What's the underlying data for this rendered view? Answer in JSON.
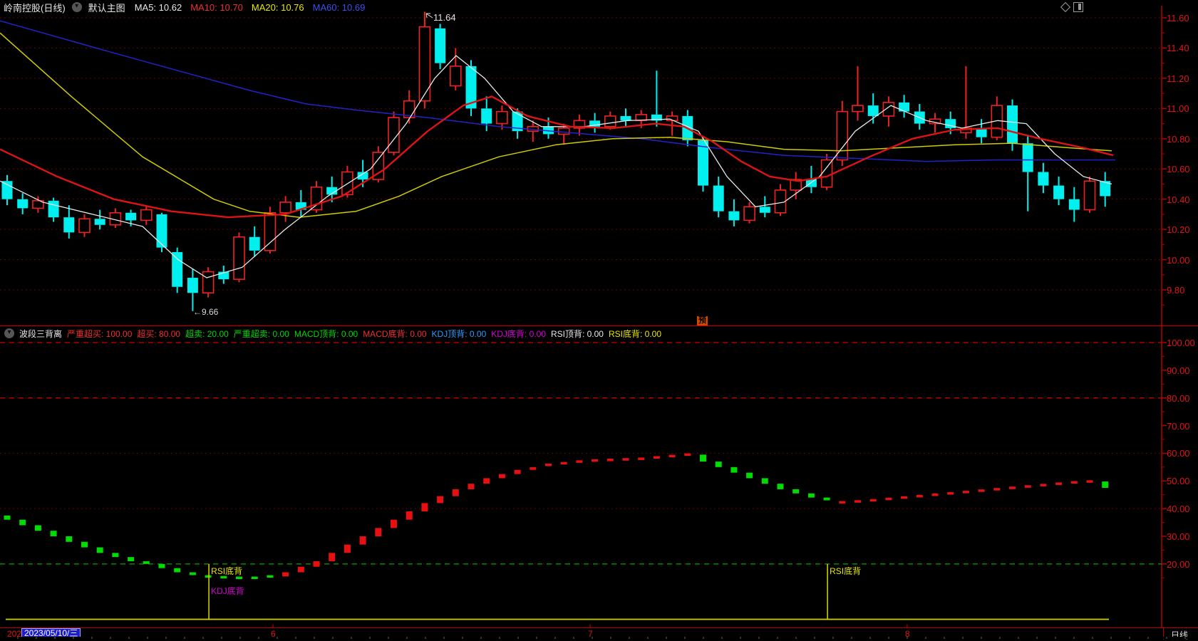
{
  "titlebar": {
    "symbol": "岭南控股(日线)",
    "preset": "默认主图",
    "ma_labels": [
      {
        "text": "MA5: 10.62",
        "color": "#e8e8e8"
      },
      {
        "text": "MA10: 10.70",
        "color": "#f03030"
      },
      {
        "text": "MA20: 10.76",
        "color": "#e8e800"
      },
      {
        "text": "MA60: 10.69",
        "color": "#3c50f0"
      }
    ]
  },
  "main_chart": {
    "y_ticks": [
      "11.60",
      "11.40",
      "11.20",
      "11.00",
      "10.80",
      "10.60",
      "10.40",
      "10.20",
      "10.00",
      "9.80"
    ],
    "high_label": "11.64",
    "low_arrow": "←",
    "low_label": "9.66",
    "alert_badge": "预"
  },
  "indicator_header": {
    "title": "波段三背离",
    "params": [
      {
        "text": "严重超买: 100.00",
        "color": "#f03030"
      },
      {
        "text": "超买: 80.00",
        "color": "#f03030"
      },
      {
        "text": "超卖: 20.00",
        "color": "#00d800"
      },
      {
        "text": "严重超卖: 0.00",
        "color": "#00d800"
      },
      {
        "text": "MACD顶背: 0.00",
        "color": "#00d800"
      },
      {
        "text": "MACD底背: 0.00",
        "color": "#f03030"
      },
      {
        "text": "KDJ顶背: 0.00",
        "color": "#2e9bff"
      },
      {
        "text": "KDJ底背: 0.00",
        "color": "#d800d8"
      },
      {
        "text": "RSI顶背: 0.00",
        "color": "#e8e8e8"
      },
      {
        "text": "RSI底背: 0.00",
        "color": "#e8e800"
      }
    ]
  },
  "indicator_panel": {
    "y_ticks": [
      "100.00",
      "90.00",
      "80.00",
      "70.00",
      "60.00",
      "50.00",
      "40.00",
      "30.00",
      "20.00"
    ],
    "annotations": [
      {
        "bar_index": 13,
        "labels": [
          {
            "text": "RSI底背",
            "color": "#e8e800"
          },
          {
            "text": "KDJ底背",
            "color": "#d800d8"
          }
        ]
      },
      {
        "bar_index": 53,
        "labels": [
          {
            "text": "RSI底背",
            "color": "#e8e800"
          }
        ]
      }
    ]
  },
  "bottom_bar": {
    "year_partial": "202",
    "date_box": "2023/05/10/三",
    "axis_labels": [
      {
        "text": "6",
        "x": 380
      },
      {
        "text": "7",
        "x": 825
      },
      {
        "text": "8",
        "x": 1270
      }
    ],
    "period": "日线"
  },
  "chart_data": {
    "type": "candlestick",
    "title": "岭南控股 日线",
    "price_axis": {
      "min": 9.66,
      "max": 11.64,
      "gridline_values": [
        11.6,
        11.4,
        11.2,
        11.0,
        10.8,
        10.6,
        10.4,
        10.2,
        10.0,
        9.8
      ]
    },
    "colors": {
      "up": "#ee2222",
      "down": "#00f0f0",
      "grid": "#8e0000",
      "axis": "#b40000",
      "ma5": "#e8e8e8",
      "ma10": "#dc1414",
      "ma20": "#cccc00",
      "ma60": "#2222cc",
      "bar_up": "#e61010",
      "bar_down": "#00dc00",
      "zero_line": "#c8c800",
      "ann_line": "#d8d800"
    },
    "candles": [
      [
        10.52,
        10.56,
        10.36,
        10.4
      ],
      [
        10.4,
        10.44,
        10.3,
        10.34
      ],
      [
        10.34,
        10.42,
        10.31,
        10.39
      ],
      [
        10.39,
        10.41,
        10.25,
        10.28
      ],
      [
        10.28,
        10.36,
        10.14,
        10.18
      ],
      [
        10.18,
        10.3,
        10.15,
        10.27
      ],
      [
        10.27,
        10.33,
        10.2,
        10.23
      ],
      [
        10.23,
        10.34,
        10.21,
        10.31
      ],
      [
        10.31,
        10.33,
        10.22,
        10.26
      ],
      [
        10.26,
        10.36,
        10.23,
        10.33
      ],
      [
        10.3,
        10.31,
        10.05,
        10.08
      ],
      [
        10.05,
        10.08,
        9.78,
        9.82
      ],
      [
        9.88,
        9.94,
        9.66,
        9.78
      ],
      [
        9.78,
        9.95,
        9.75,
        9.92
      ],
      [
        9.92,
        9.96,
        9.84,
        9.87
      ],
      [
        9.87,
        10.18,
        9.85,
        10.15
      ],
      [
        10.15,
        10.22,
        10.02,
        10.06
      ],
      [
        10.06,
        10.35,
        10.04,
        10.31
      ],
      [
        10.31,
        10.42,
        10.25,
        10.38
      ],
      [
        10.38,
        10.46,
        10.28,
        10.33
      ],
      [
        10.33,
        10.52,
        10.31,
        10.48
      ],
      [
        10.48,
        10.55,
        10.38,
        10.43
      ],
      [
        10.43,
        10.62,
        10.41,
        10.58
      ],
      [
        10.58,
        10.66,
        10.48,
        10.53
      ],
      [
        10.53,
        10.75,
        10.51,
        10.71
      ],
      [
        10.71,
        10.98,
        10.69,
        10.94
      ],
      [
        10.94,
        11.12,
        10.9,
        11.05
      ],
      [
        11.05,
        11.64,
        11.0,
        11.54
      ],
      [
        11.53,
        11.56,
        11.26,
        11.3
      ],
      [
        11.15,
        11.4,
        11.12,
        11.28
      ],
      [
        11.28,
        11.32,
        10.95,
        11.0
      ],
      [
        11.0,
        11.08,
        10.85,
        10.9
      ],
      [
        10.9,
        11.02,
        10.86,
        10.98
      ],
      [
        10.98,
        11.0,
        10.8,
        10.85
      ],
      [
        10.85,
        10.92,
        10.78,
        10.88
      ],
      [
        10.88,
        10.94,
        10.8,
        10.83
      ],
      [
        10.83,
        10.9,
        10.76,
        10.87
      ],
      [
        10.87,
        10.96,
        10.82,
        10.92
      ],
      [
        10.92,
        10.97,
        10.84,
        10.88
      ],
      [
        10.88,
        10.98,
        10.86,
        10.95
      ],
      [
        10.95,
        11.0,
        10.88,
        10.92
      ],
      [
        10.92,
        10.99,
        10.87,
        10.96
      ],
      [
        10.96,
        11.25,
        10.88,
        10.92
      ],
      [
        10.92,
        10.98,
        10.82,
        10.95
      ],
      [
        10.95,
        10.99,
        10.75,
        10.79
      ],
      [
        10.79,
        10.82,
        10.45,
        10.49
      ],
      [
        10.49,
        10.55,
        10.28,
        10.32
      ],
      [
        10.32,
        10.4,
        10.22,
        10.26
      ],
      [
        10.26,
        10.38,
        10.24,
        10.35
      ],
      [
        10.35,
        10.42,
        10.28,
        10.31
      ],
      [
        10.31,
        10.5,
        10.29,
        10.46
      ],
      [
        10.46,
        10.58,
        10.4,
        10.53
      ],
      [
        10.53,
        10.62,
        10.44,
        10.48
      ],
      [
        10.48,
        10.7,
        10.46,
        10.66
      ],
      [
        10.66,
        11.05,
        10.62,
        10.98
      ],
      [
        10.98,
        11.28,
        10.92,
        11.02
      ],
      [
        11.02,
        11.1,
        10.9,
        10.95
      ],
      [
        10.95,
        11.08,
        10.88,
        11.04
      ],
      [
        11.04,
        11.09,
        10.94,
        10.98
      ],
      [
        10.98,
        11.03,
        10.86,
        10.9
      ],
      [
        10.9,
        10.97,
        10.84,
        10.93
      ],
      [
        10.93,
        10.98,
        10.83,
        10.87
      ],
      [
        10.84,
        11.28,
        10.8,
        10.87
      ],
      [
        10.87,
        10.93,
        10.77,
        10.81
      ],
      [
        10.81,
        11.08,
        10.79,
        11.02
      ],
      [
        11.02,
        11.06,
        10.72,
        10.77
      ],
      [
        10.77,
        10.82,
        10.32,
        10.58
      ],
      [
        10.58,
        10.64,
        10.44,
        10.49
      ],
      [
        10.49,
        10.55,
        10.36,
        10.4
      ],
      [
        10.4,
        10.48,
        10.25,
        10.33
      ],
      [
        10.33,
        10.55,
        10.31,
        10.52
      ],
      [
        10.52,
        10.58,
        10.35,
        10.42
      ]
    ],
    "ma_lines": {
      "ma5": [
        [
          0,
          10.52
        ],
        [
          60,
          10.38
        ],
        [
          130,
          10.3
        ],
        [
          200,
          10.22
        ],
        [
          250,
          10.0
        ],
        [
          290,
          9.88
        ],
        [
          340,
          9.95
        ],
        [
          400,
          10.2
        ],
        [
          460,
          10.42
        ],
        [
          520,
          10.6
        ],
        [
          570,
          10.9
        ],
        [
          610,
          11.2
        ],
        [
          640,
          11.35
        ],
        [
          680,
          11.2
        ],
        [
          720,
          10.98
        ],
        [
          760,
          10.88
        ],
        [
          820,
          10.88
        ],
        [
          880,
          10.92
        ],
        [
          940,
          10.93
        ],
        [
          980,
          10.85
        ],
        [
          1020,
          10.55
        ],
        [
          1060,
          10.35
        ],
        [
          1100,
          10.38
        ],
        [
          1150,
          10.55
        ],
        [
          1200,
          10.85
        ],
        [
          1250,
          11.02
        ],
        [
          1300,
          10.92
        ],
        [
          1350,
          10.87
        ],
        [
          1400,
          10.92
        ],
        [
          1440,
          10.9
        ],
        [
          1480,
          10.7
        ],
        [
          1520,
          10.55
        ],
        [
          1560,
          10.5
        ]
      ],
      "ma10": [
        [
          0,
          10.73
        ],
        [
          80,
          10.55
        ],
        [
          160,
          10.4
        ],
        [
          240,
          10.32
        ],
        [
          320,
          10.28
        ],
        [
          400,
          10.3
        ],
        [
          480,
          10.42
        ],
        [
          540,
          10.6
        ],
        [
          600,
          10.85
        ],
        [
          650,
          11.02
        ],
        [
          690,
          11.08
        ],
        [
          740,
          10.95
        ],
        [
          800,
          10.88
        ],
        [
          860,
          10.87
        ],
        [
          920,
          10.9
        ],
        [
          960,
          10.88
        ],
        [
          1000,
          10.78
        ],
        [
          1040,
          10.65
        ],
        [
          1080,
          10.55
        ],
        [
          1120,
          10.52
        ],
        [
          1160,
          10.55
        ],
        [
          1220,
          10.68
        ],
        [
          1280,
          10.8
        ],
        [
          1340,
          10.86
        ],
        [
          1400,
          10.87
        ],
        [
          1460,
          10.8
        ],
        [
          1520,
          10.74
        ],
        [
          1562,
          10.69
        ]
      ],
      "ma20": [
        [
          0,
          11.5
        ],
        [
          100,
          11.08
        ],
        [
          200,
          10.68
        ],
        [
          300,
          10.4
        ],
        [
          350,
          10.32
        ],
        [
          420,
          10.28
        ],
        [
          500,
          10.32
        ],
        [
          560,
          10.42
        ],
        [
          620,
          10.55
        ],
        [
          700,
          10.68
        ],
        [
          780,
          10.76
        ],
        [
          860,
          10.8
        ],
        [
          940,
          10.81
        ],
        [
          1020,
          10.78
        ],
        [
          1100,
          10.73
        ],
        [
          1180,
          10.72
        ],
        [
          1260,
          10.74
        ],
        [
          1340,
          10.76
        ],
        [
          1420,
          10.77
        ],
        [
          1500,
          10.74
        ],
        [
          1560,
          10.72
        ]
      ],
      "ma60": [
        [
          0,
          11.58
        ],
        [
          60,
          11.5
        ],
        [
          150,
          11.38
        ],
        [
          250,
          11.25
        ],
        [
          350,
          11.12
        ],
        [
          430,
          11.03
        ],
        [
          500,
          10.99
        ],
        [
          600,
          10.94
        ],
        [
          700,
          10.88
        ],
        [
          800,
          10.84
        ],
        [
          900,
          10.8
        ],
        [
          1000,
          10.74
        ],
        [
          1100,
          10.69
        ],
        [
          1200,
          10.67
        ],
        [
          1300,
          10.65
        ],
        [
          1400,
          10.66
        ],
        [
          1500,
          10.66
        ],
        [
          1565,
          10.66
        ]
      ]
    },
    "indicator": {
      "type": "bar",
      "name": "波段三背离",
      "levels": {
        "overbought_extreme": 100,
        "overbought": 80,
        "oversold": 20,
        "oversold_extreme": 0
      },
      "axis_range": [
        0,
        100
      ],
      "values": [
        36,
        34,
        32,
        30,
        28,
        26,
        24,
        22.5,
        21,
        20,
        18.5,
        17,
        16,
        15.5,
        15.2,
        15,
        15,
        15.5,
        17,
        19,
        21,
        24,
        27,
        30,
        33,
        36,
        39,
        42,
        44.5,
        47,
        49,
        51,
        52.5,
        54,
        55,
        55.8,
        56.4,
        57,
        57.4,
        57.6,
        57.8,
        58,
        58.5,
        59,
        59.5,
        57,
        55,
        53,
        51,
        49,
        47,
        45.5,
        44,
        43,
        42.3,
        42.6,
        43,
        43.5,
        44,
        44.5,
        45,
        45.5,
        46,
        46.5,
        47,
        47.5,
        48,
        48.5,
        49,
        49.5,
        49.8,
        47.5
      ],
      "colors": [
        "g",
        "g",
        "g",
        "g",
        "g",
        "g",
        "g",
        "g",
        "g",
        "g",
        "g",
        "g",
        "g",
        "g",
        "g",
        "g",
        "g",
        "g",
        "r",
        "r",
        "r",
        "r",
        "r",
        "r",
        "r",
        "r",
        "r",
        "r",
        "r",
        "r",
        "r",
        "r",
        "r",
        "r",
        "r",
        "r",
        "r",
        "r",
        "r",
        "r",
        "r",
        "r",
        "r",
        "r",
        "r",
        "g",
        "g",
        "g",
        "g",
        "g",
        "g",
        "g",
        "g",
        "g",
        "r",
        "r",
        "r",
        "r",
        "r",
        "r",
        "r",
        "r",
        "r",
        "r",
        "r",
        "r",
        "r",
        "r",
        "r",
        "r",
        "r",
        "g"
      ]
    }
  }
}
